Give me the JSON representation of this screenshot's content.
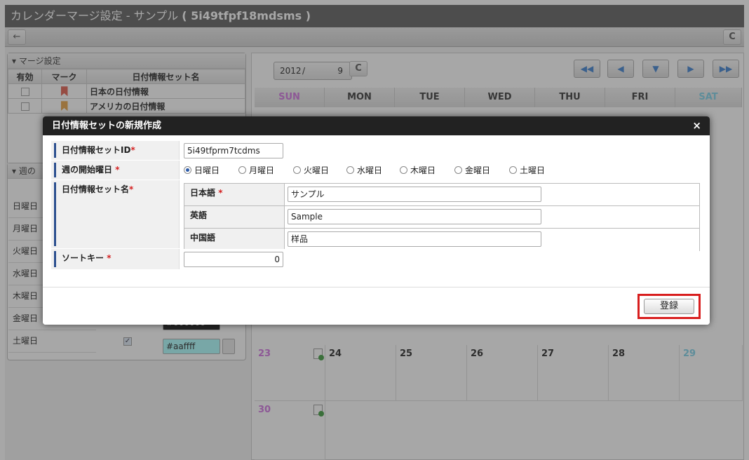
{
  "window": {
    "title_prefix": "カレンダーマージ設定 - サンプル",
    "title_id": "( 5i49tfpf18mdsms )"
  },
  "toolbar": {
    "back_icon": "←",
    "refresh_icon": "C"
  },
  "merge_panel": {
    "title": "▾ マージ設定",
    "col_enabled": "有効",
    "col_mark": "マーク",
    "col_name": "日付情報セット名",
    "rows": [
      {
        "name": "日本の日付情報"
      },
      {
        "name": "アメリカの日付情報"
      }
    ]
  },
  "week_panel": {
    "title": "▾ 週の",
    "days": [
      "日曜日",
      "月曜日",
      "火曜日",
      "水曜日",
      "木曜日",
      "金曜日",
      "土曜日"
    ],
    "color_fri": "#000000",
    "color_sat": "#aaffff"
  },
  "calendar": {
    "year": "2012",
    "sep": "/",
    "month": "9",
    "weekdays": [
      "SUN",
      "MON",
      "TUE",
      "WED",
      "THU",
      "FRI",
      "SAT"
    ],
    "row4": [
      "23",
      "24",
      "25",
      "26",
      "27",
      "28",
      "29"
    ],
    "row5": [
      "30"
    ],
    "nav": [
      "◀◀",
      "◀",
      "▼",
      "▶",
      "▶▶"
    ]
  },
  "modal": {
    "title": "日付情報セットの新規作成",
    "close": "×",
    "id_label": "日付情報セットID",
    "id_value": "5i49tfprm7tcdms",
    "start_day_label": "週の開始曜日",
    "start_days": [
      "日曜日",
      "月曜日",
      "火曜日",
      "水曜日",
      "木曜日",
      "金曜日",
      "土曜日"
    ],
    "name_label": "日付情報セット名",
    "lang_ja": "日本語",
    "lang_en": "英語",
    "lang_zh": "中国語",
    "name_ja": "サンプル",
    "name_en": "Sample",
    "name_zh": "样品",
    "sort_label": "ソートキー",
    "sort_value": "0",
    "required_mark": "*",
    "register": "登録"
  },
  "colors": {
    "accent": "#2b4f8f",
    "required": "#d42020",
    "highlight": "#d81e1e"
  }
}
